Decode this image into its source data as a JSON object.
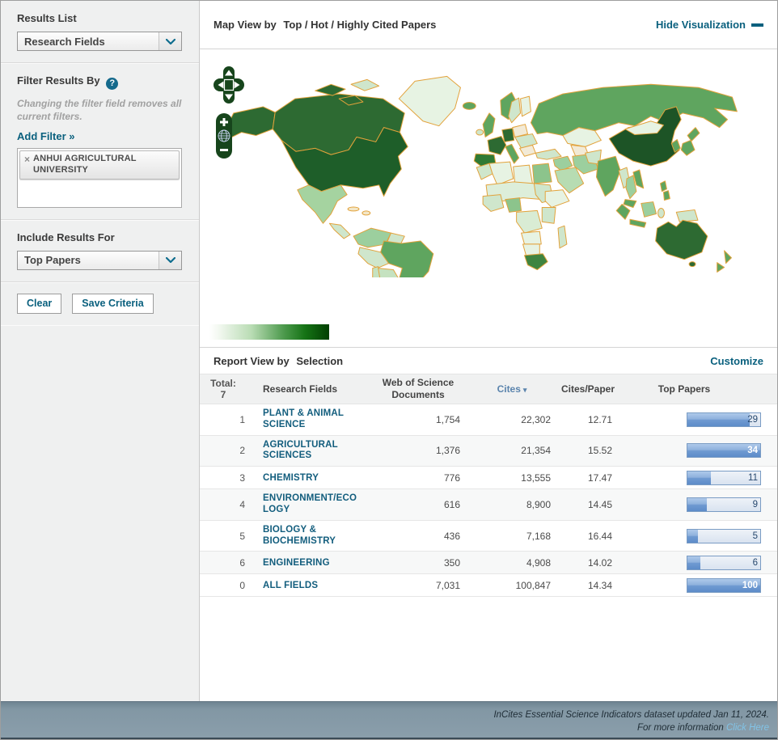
{
  "sidebar": {
    "results_list": {
      "label": "Results List",
      "selected": "Research Fields"
    },
    "filter": {
      "label": "Filter Results By",
      "help_icon": "?",
      "note": "Changing the filter field removes all current filters.",
      "add_filter": "Add Filter »",
      "tag": {
        "remove_icon": "×",
        "label": "ANHUI AGRICULTURAL UNIVERSITY"
      }
    },
    "include_results": {
      "label": "Include Results For",
      "selected": "Top Papers"
    },
    "buttons": {
      "clear": "Clear",
      "save": "Save Criteria"
    }
  },
  "map_view": {
    "title_prefix": "Map View by",
    "title": "Top / Hot / Highly Cited Papers",
    "hide_link": "Hide Visualization"
  },
  "report": {
    "title_prefix": "Report View by",
    "title": "Selection",
    "customize": "Customize",
    "table": {
      "header": {
        "total_label": "Total:",
        "total_value": "7",
        "fields": "Research Fields",
        "docs": "Web of Science Documents",
        "cites": "Cites",
        "sort_icon": "▾",
        "cites_per_paper": "Cites/Paper",
        "top_papers": "Top Papers"
      },
      "rows": [
        {
          "rank": "1",
          "field": "PLANT & ANIMAL SCIENCE",
          "docs": "1,754",
          "cites": "22,302",
          "cpp": "12.71",
          "top_papers": 29
        },
        {
          "rank": "2",
          "field": "AGRICULTURAL SCIENCES",
          "docs": "1,376",
          "cites": "21,354",
          "cpp": "15.52",
          "top_papers": 34
        },
        {
          "rank": "3",
          "field": "CHEMISTRY",
          "docs": "776",
          "cites": "13,555",
          "cpp": "17.47",
          "top_papers": 11
        },
        {
          "rank": "4",
          "field": "ENVIRONMENT/ECOLOGY",
          "docs": "616",
          "cites": "8,900",
          "cpp": "14.45",
          "top_papers": 9
        },
        {
          "rank": "5",
          "field": "BIOLOGY & BIOCHEMISTRY",
          "docs": "436",
          "cites": "7,168",
          "cpp": "16.44",
          "top_papers": 5
        },
        {
          "rank": "6",
          "field": "ENGINEERING",
          "docs": "350",
          "cites": "4,908",
          "cpp": "14.02",
          "top_papers": 6
        },
        {
          "rank": "0",
          "field": "ALL FIELDS",
          "docs": "7,031",
          "cites": "100,847",
          "cpp": "14.34",
          "top_papers": 100
        }
      ]
    }
  },
  "footer": {
    "line1": "InCites Essential Science Indicators dataset updated Jan 11, 2024.",
    "line2_prefix": "For more information",
    "link": "Click Here"
  },
  "colors": {
    "accent_teal": "#0a607e",
    "bar_blue": "#5d8cc9",
    "map_border_orange": "#e2a23b",
    "map_scale": [
      "#ffffff",
      "#e7f3e3",
      "#cfe6cc",
      "#9ccf9e",
      "#5fa55f",
      "#2d6a32",
      "#1d5426"
    ],
    "footer_bg": "#8a9eab"
  }
}
